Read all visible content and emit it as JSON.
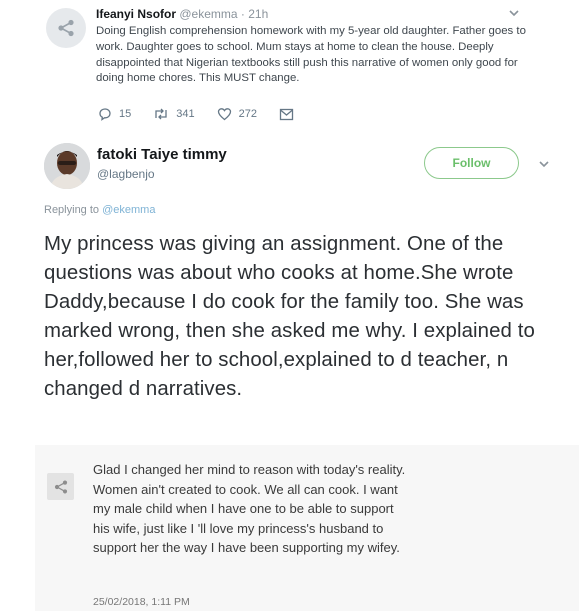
{
  "quoted_tweet": {
    "name": "Ifeanyi Nsofor",
    "handle": "@ekemma",
    "time": "· 21h",
    "text": "Doing English comprehension homework with my 5-year old daughter. Father goes to work. Daughter goes to school. Mum stays at home to clean the house. Deeply disappointed that Nigerian textbooks still push this narrative of women only good for doing home chores. This MUST change.",
    "replies": "15",
    "retweets": "341",
    "likes": "272"
  },
  "reply_tweet": {
    "name": "fatoki Taiye timmy",
    "handle": "@lagbenjo",
    "follow_label": "Follow",
    "replying_prefix": "Replying to",
    "replying_mention": "@ekemma",
    "text": "My princess was giving an assignment. One of the questions was about who cooks at home.She wrote Daddy,because I do cook for the family too. She was marked wrong, then she asked me why. I explained to her,followed her to school,explained to d teacher, n changed d narratives."
  },
  "embedded_screenshot": {
    "text": "Glad I changed her mind to reason with today's reality. Women ain't created to cook. We all can cook. I want my male child when I have one to be able to support his wife, just like I 'll love my princess's husband to support her the way I have been supporting my wifey.",
    "date": "25/02/2018, 1:11 PM"
  },
  "colors": {
    "follow_green": "#6bbf6b",
    "mention_blue": "#7fb3d5",
    "muted_gray": "#8a939b"
  },
  "icons": [
    "share-icon",
    "chevron-down-icon",
    "reply-icon",
    "retweet-icon",
    "heart-icon",
    "message-icon"
  ]
}
